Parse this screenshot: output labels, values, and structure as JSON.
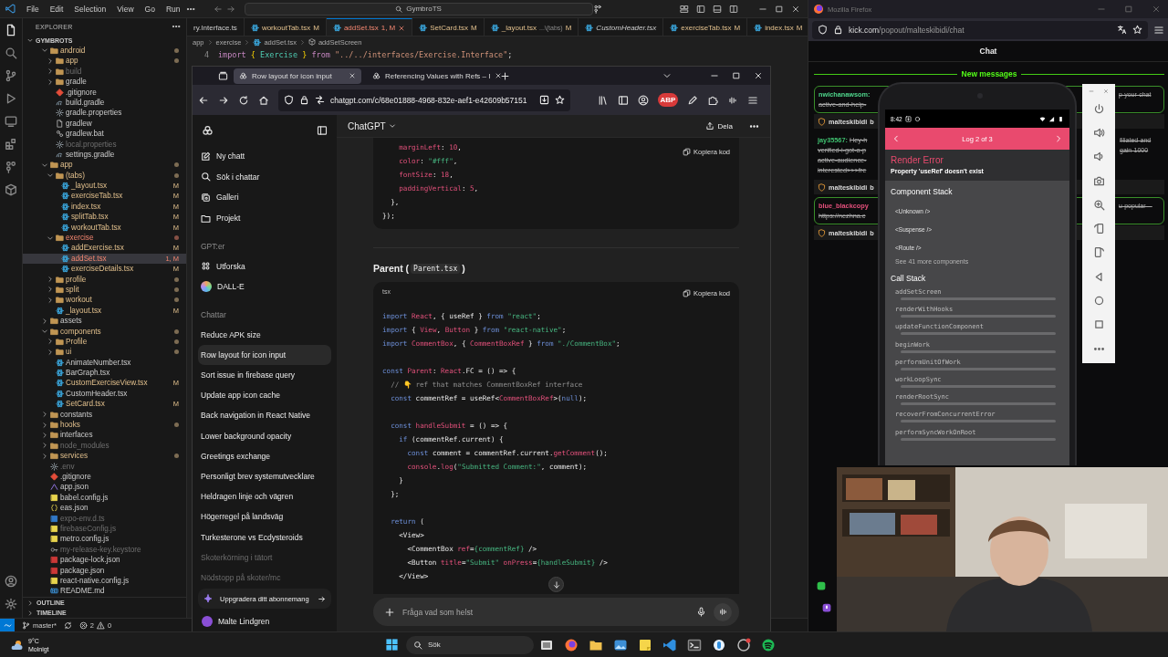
{
  "vscode": {
    "menu": [
      "File",
      "Edit",
      "Selection",
      "View",
      "Go",
      "Run"
    ],
    "command_center": "GymbroTS",
    "explorer": {
      "title": "EXPLORER",
      "root": {
        "name": "GYMBROTS",
        "expanded": true
      },
      "tree": [
        {
          "name": "android",
          "kind": "folder",
          "expanded": true,
          "modified": true,
          "dot": true,
          "selected": false,
          "children": [
            {
              "name": "app",
              "kind": "folder",
              "expanded": false,
              "modified": true,
              "dot": true,
              "selected": false
            },
            {
              "name": "build",
              "kind": "folder",
              "expanded": false,
              "ignored": true,
              "selected": false
            },
            {
              "name": "gradle",
              "kind": "folder",
              "expanded": false,
              "selected": false
            },
            {
              "name": ".gitignore",
              "kind": "git",
              "selected": false
            },
            {
              "name": "build.gradle",
              "kind": "gradle",
              "selected": false
            },
            {
              "name": "gradle.properties",
              "kind": "config",
              "selected": false
            },
            {
              "name": "gradlew",
              "kind": "file",
              "selected": false
            },
            {
              "name": "gradlew.bat",
              "kind": "script",
              "selected": false
            },
            {
              "name": "local.properties",
              "kind": "config",
              "ignored": true,
              "selected": false
            },
            {
              "name": "settings.gradle",
              "kind": "gradle",
              "selected": false
            }
          ]
        },
        {
          "name": "app",
          "kind": "folder",
          "expanded": true,
          "modified": true,
          "dot": true,
          "selected": false,
          "children": [
            {
              "name": "(tabs)",
              "kind": "folder",
              "expanded": true,
              "modified": true,
              "dot": true,
              "selected": false,
              "children": [
                {
                  "name": "_layout.tsx",
                  "kind": "tsx",
                  "modified": true,
                  "badge": "M",
                  "selected": false
                },
                {
                  "name": "exerciseTab.tsx",
                  "kind": "tsx",
                  "modified": true,
                  "badge": "M",
                  "selected": false
                },
                {
                  "name": "index.tsx",
                  "kind": "tsx",
                  "modified": true,
                  "badge": "M",
                  "selected": false
                },
                {
                  "name": "splitTab.tsx",
                  "kind": "tsx",
                  "modified": true,
                  "badge": "M",
                  "selected": false
                },
                {
                  "name": "workoutTab.tsx",
                  "kind": "tsx",
                  "modified": true,
                  "badge": "M",
                  "selected": false
                }
              ]
            },
            {
              "name": "exercise",
              "kind": "folder",
              "expanded": true,
              "error": true,
              "dot": true,
              "selected": false,
              "children": [
                {
                  "name": "addExercise.tsx",
                  "kind": "tsx",
                  "modified": true,
                  "badge": "M",
                  "selected": false
                },
                {
                  "name": "addSet.tsx",
                  "kind": "tsx",
                  "error": true,
                  "badge": "1, M",
                  "selected": true
                },
                {
                  "name": "exerciseDetails.tsx",
                  "kind": "tsx",
                  "modified": true,
                  "badge": "M",
                  "selected": false
                }
              ]
            },
            {
              "name": "profile",
              "kind": "folder",
              "expanded": false,
              "modified": true,
              "dot": true,
              "selected": false
            },
            {
              "name": "split",
              "kind": "folder",
              "expanded": false,
              "modified": true,
              "dot": true,
              "selected": false
            },
            {
              "name": "workout",
              "kind": "folder",
              "expanded": false,
              "modified": true,
              "dot": true,
              "selected": false
            },
            {
              "name": "_layout.tsx",
              "kind": "tsx",
              "modified": true,
              "badge": "M",
              "selected": false
            }
          ]
        },
        {
          "name": "assets",
          "kind": "folder",
          "expanded": false,
          "selected": false
        },
        {
          "name": "components",
          "kind": "folder",
          "expanded": true,
          "modified": true,
          "dot": true,
          "selected": false,
          "children": [
            {
              "name": "Profile",
              "kind": "folder",
              "expanded": false,
              "modified": true,
              "dot": true,
              "selected": false
            },
            {
              "name": "ui",
              "kind": "folder",
              "expanded": false,
              "modified": true,
              "dot": true,
              "selected": false
            },
            {
              "name": "AnimateNumber.tsx",
              "kind": "tsx",
              "selected": false
            },
            {
              "name": "BarGraph.tsx",
              "kind": "tsx",
              "selected": false
            },
            {
              "name": "CustomExerciseView.tsx",
              "kind": "tsx",
              "modified": true,
              "badge": "M",
              "selected": false
            },
            {
              "name": "CustomHeader.tsx",
              "kind": "tsx",
              "selected": false
            },
            {
              "name": "SetCard.tsx",
              "kind": "tsx",
              "modified": true,
              "badge": "M",
              "selected": false
            }
          ]
        },
        {
          "name": "constants",
          "kind": "folder",
          "expanded": false,
          "selected": false
        },
        {
          "name": "hooks",
          "kind": "folder",
          "expanded": false,
          "modified": true,
          "dot": true,
          "selected": false
        },
        {
          "name": "interfaces",
          "kind": "folder",
          "expanded": false,
          "selected": false
        },
        {
          "name": "node_modules",
          "kind": "folder",
          "expanded": false,
          "ignored": true,
          "selected": false
        },
        {
          "name": "services",
          "kind": "folder",
          "expanded": false,
          "modified": true,
          "dot": true,
          "selected": false
        },
        {
          "name": ".env",
          "kind": "config",
          "ignored": true,
          "selected": false
        },
        {
          "name": ".gitignore",
          "kind": "git",
          "selected": false
        },
        {
          "name": "app.json",
          "kind": "expo",
          "selected": false
        },
        {
          "name": "babel.config.js",
          "kind": "js",
          "selected": false
        },
        {
          "name": "eas.json",
          "kind": "json",
          "selected": false
        },
        {
          "name": "expo-env.d.ts",
          "kind": "ts",
          "ignored": true,
          "selected": false
        },
        {
          "name": "firebaseConfig.js",
          "kind": "js",
          "ignored": true,
          "selected": false
        },
        {
          "name": "metro.config.js",
          "kind": "js",
          "selected": false
        },
        {
          "name": "my-release-key.keystore",
          "kind": "key",
          "ignored": true,
          "selected": false
        },
        {
          "name": "package-lock.json",
          "kind": "npm",
          "selected": false
        },
        {
          "name": "package.json",
          "kind": "npm",
          "selected": false
        },
        {
          "name": "react-native.config.js",
          "kind": "js",
          "selected": false
        },
        {
          "name": "README.md",
          "kind": "md",
          "selected": false
        }
      ]
    },
    "panels": [
      {
        "label": "OUTLINE",
        "expanded": false
      },
      {
        "label": "TIMELINE",
        "expanded": false
      }
    ],
    "tabs": [
      {
        "name": "ry.Interface.ts",
        "selected": false
      },
      {
        "name": "workoutTab.tsx",
        "kind": "tsx",
        "badge": "M",
        "modified": true,
        "selected": false
      },
      {
        "name": "addSet.tsx",
        "kind": "tsx",
        "badge": "1, M",
        "error": true,
        "selected": true
      },
      {
        "name": "SetCard.tsx",
        "kind": "tsx",
        "badge": "M",
        "modified": true,
        "selected": false
      },
      {
        "name": "_layout.tsx",
        "kind": "tsx",
        "description": "...\\(tabs)",
        "badge": "M",
        "modified": true,
        "selected": false
      },
      {
        "name": "CustomHeader.tsx",
        "kind": "tsx",
        "preview": true,
        "selected": false
      },
      {
        "name": "exerciseTab.tsx",
        "kind": "tsx",
        "badge": "M",
        "modified": true,
        "selected": false
      },
      {
        "name": "index.tsx",
        "kind": "tsx",
        "badge": "M",
        "modified": true,
        "selected": false
      }
    ],
    "breadcrumb": [
      "app",
      "exercise",
      "addSet.tsx",
      "addSetScreen"
    ],
    "editor_line": {
      "number": "4",
      "tokens": [
        {
          "kind": "kw",
          "text": "import "
        },
        {
          "kind": "br",
          "text": "{ "
        },
        {
          "kind": "ty",
          "text": "Exercise"
        },
        {
          "kind": "br",
          "text": " } "
        },
        {
          "kind": "kw",
          "text": "from "
        },
        {
          "kind": "str",
          "text": "\"../../interfaces/Exercise.Interface\""
        },
        {
          "kind": "pl",
          "text": ";"
        }
      ]
    },
    "status_bar": {
      "branch": "master*",
      "errors": "2",
      "warnings": "0"
    }
  },
  "browser": {
    "tabs": [
      {
        "title": "Row layout for icon input",
        "selected": true
      },
      {
        "title": "Referencing Values with Refs – I",
        "selected": false
      }
    ],
    "url": "chatgpt.com/c/68e01888-4968-832e-aef1-e42609b57151",
    "extension_badge": "ABP"
  },
  "chatgpt": {
    "nav": [
      {
        "label": "Ny chatt",
        "kind": "edit"
      },
      {
        "label": "Sök i chattar",
        "kind": "search"
      },
      {
        "label": "Galleri",
        "kind": "gallery"
      },
      {
        "label": "Projekt",
        "kind": "folder"
      }
    ],
    "gpts_heading": "GPT:er",
    "gpts": [
      {
        "label": "Utforska",
        "kind": "grid"
      },
      {
        "label": "DALL-E",
        "kind": "avatar"
      }
    ],
    "chats_heading": "Chattar",
    "chats": [
      {
        "title": "Reduce APK size",
        "selected": false
      },
      {
        "title": "Row layout for icon input",
        "selected": true
      },
      {
        "title": "Sort issue in firebase query",
        "selected": false
      },
      {
        "title": "Update app icon cache",
        "selected": false
      },
      {
        "title": "Back navigation in React Native",
        "selected": false
      },
      {
        "title": "Lower background opacity",
        "selected": false
      },
      {
        "title": "Greetings exchange",
        "selected": false
      },
      {
        "title": "Personligt brev systemutvecklare",
        "selected": false
      },
      {
        "title": "Heldragen linje och vägren",
        "selected": false
      },
      {
        "title": "Högerregel på landsväg",
        "selected": false
      },
      {
        "title": "Turkesterone vs Ecdysteroids",
        "selected": false
      },
      {
        "title": "Skoterkörning i tätort",
        "selected": false,
        "faded": true
      },
      {
        "title": "Nödstopp på skoter/mc",
        "selected": false,
        "faded": true
      }
    ],
    "upgrade": "Uppgradera ditt abonnemang",
    "user": "Malte Lindgren",
    "model": "ChatGPT",
    "share": "Dela",
    "blocks": [
      {
        "kind": "code",
        "copy": "Kopiera kod",
        "lines": [
          {
            "tokens": [
              {
                "kind": "id",
                "text": "    marginLeft"
              },
              {
                "kind": "pl",
                "text": ": "
              },
              {
                "kind": "num",
                "text": "10"
              },
              {
                "kind": "pl",
                "text": ","
              }
            ]
          },
          {
            "tokens": [
              {
                "kind": "id",
                "text": "    color"
              },
              {
                "kind": "pl",
                "text": ": "
              },
              {
                "kind": "str",
                "text": "\"#fff\""
              },
              {
                "kind": "pl",
                "text": ","
              }
            ]
          },
          {
            "tokens": [
              {
                "kind": "id",
                "text": "    fontSize"
              },
              {
                "kind": "pl",
                "text": ": "
              },
              {
                "kind": "num",
                "text": "18"
              },
              {
                "kind": "pl",
                "text": ","
              }
            ]
          },
          {
            "tokens": [
              {
                "kind": "id",
                "text": "    paddingVertical"
              },
              {
                "kind": "pl",
                "text": ": "
              },
              {
                "kind": "num",
                "text": "5"
              },
              {
                "kind": "pl",
                "text": ","
              }
            ]
          },
          {
            "tokens": [
              {
                "kind": "pl",
                "text": "  },"
              }
            ]
          },
          {
            "tokens": [
              {
                "kind": "pl",
                "text": "});"
              }
            ]
          }
        ]
      },
      {
        "kind": "heading",
        "text": "Parent (",
        "code": "Parent.tsx",
        "after": ")"
      },
      {
        "kind": "code",
        "language": "tsx",
        "copy": "Kopiera kod",
        "lines": [
          {
            "tokens": [
              {
                "kind": "kw",
                "text": "import "
              },
              {
                "kind": "id",
                "text": "React"
              },
              {
                "kind": "pl",
                "text": ", { useRef } "
              },
              {
                "kind": "kw",
                "text": "from "
              },
              {
                "kind": "str",
                "text": "\"react\""
              },
              {
                "kind": "pl",
                "text": ";"
              }
            ]
          },
          {
            "tokens": [
              {
                "kind": "kw",
                "text": "import "
              },
              {
                "kind": "pl",
                "text": "{ "
              },
              {
                "kind": "id",
                "text": "View"
              },
              {
                "kind": "pl",
                "text": ", "
              },
              {
                "kind": "id",
                "text": "Button"
              },
              {
                "kind": "pl",
                "text": " } "
              },
              {
                "kind": "kw",
                "text": "from "
              },
              {
                "kind": "str",
                "text": "\"react-native\""
              },
              {
                "kind": "pl",
                "text": ";"
              }
            ]
          },
          {
            "tokens": [
              {
                "kind": "kw",
                "text": "import "
              },
              {
                "kind": "id",
                "text": "CommentBox"
              },
              {
                "kind": "pl",
                "text": ", { "
              },
              {
                "kind": "id",
                "text": "CommentBoxRef"
              },
              {
                "kind": "pl",
                "text": " } "
              },
              {
                "kind": "kw",
                "text": "from "
              },
              {
                "kind": "str",
                "text": "\"./CommentBox\""
              },
              {
                "kind": "pl",
                "text": ";"
              }
            ]
          },
          {
            "blank_before": true,
            "tokens": [
              {
                "kind": "kw",
                "text": "const "
              },
              {
                "kind": "id",
                "text": "Parent"
              },
              {
                "kind": "pl",
                "text": ": "
              },
              {
                "kind": "id",
                "text": "React"
              },
              {
                "kind": "pl",
                "text": ".FC = () => {"
              }
            ]
          },
          {
            "tokens": [
              {
                "kind": "cm",
                "text": "  // 👇 ref that matches CommentBoxRef interface"
              }
            ]
          },
          {
            "tokens": [
              {
                "kind": "kw",
                "text": "  const "
              },
              {
                "kind": "pl",
                "text": "commentRef = useRef<"
              },
              {
                "kind": "id",
                "text": "CommentBoxRef"
              },
              {
                "kind": "pl",
                "text": ">("
              },
              {
                "kind": "kw",
                "text": "null"
              },
              {
                "kind": "pl",
                "text": ");"
              }
            ]
          },
          {
            "blank_before": true,
            "tokens": [
              {
                "kind": "kw",
                "text": "  const "
              },
              {
                "kind": "id",
                "text": "handleSubmit"
              },
              {
                "kind": "pl",
                "text": " = () => {"
              }
            ]
          },
          {
            "tokens": [
              {
                "kind": "kw",
                "text": "    if "
              },
              {
                "kind": "pl",
                "text": "(commentRef.current) {"
              }
            ]
          },
          {
            "tokens": [
              {
                "kind": "kw",
                "text": "      const "
              },
              {
                "kind": "pl",
                "text": "comment = commentRef.current."
              },
              {
                "kind": "id",
                "text": "getComment"
              },
              {
                "kind": "pl",
                "text": "();"
              }
            ]
          },
          {
            "tokens": [
              {
                "kind": "id",
                "text": "      console"
              },
              {
                "kind": "pl",
                "text": "."
              },
              {
                "kind": "id",
                "text": "log"
              },
              {
                "kind": "pl",
                "text": "("
              },
              {
                "kind": "str",
                "text": "\"Submitted Comment:\""
              },
              {
                "kind": "pl",
                "text": ", comment);"
              }
            ]
          },
          {
            "tokens": [
              {
                "kind": "pl",
                "text": "    }"
              }
            ]
          },
          {
            "tokens": [
              {
                "kind": "pl",
                "text": "  };"
              }
            ]
          },
          {
            "blank_before": true,
            "tokens": [
              {
                "kind": "kw",
                "text": "  return "
              },
              {
                "kind": "pl",
                "text": "("
              }
            ]
          },
          {
            "tokens": [
              {
                "kind": "pl",
                "text": "    <View>"
              }
            ]
          },
          {
            "tokens": [
              {
                "kind": "pl",
                "text": "      <CommentBox "
              },
              {
                "kind": "id",
                "text": "ref"
              },
              {
                "kind": "pl",
                "text": "="
              },
              {
                "kind": "str",
                "text": "{commentRef}"
              },
              {
                "kind": "pl",
                "text": " />"
              }
            ]
          },
          {
            "tokens": [
              {
                "kind": "pl",
                "text": "      <Button "
              },
              {
                "kind": "id",
                "text": "title"
              },
              {
                "kind": "pl",
                "text": "="
              },
              {
                "kind": "str",
                "text": "\"Submit\" "
              },
              {
                "kind": "id",
                "text": "onPress"
              },
              {
                "kind": "pl",
                "text": "="
              },
              {
                "kind": "str",
                "text": "{handleSubmit}"
              },
              {
                "kind": "pl",
                "text": " />"
              }
            ]
          },
          {
            "tokens": [
              {
                "kind": "pl",
                "text": "    </View>"
              }
            ]
          }
        ]
      }
    ],
    "composer_placeholder": "Fråga vad som helst"
  },
  "kick": {
    "window_title": "Mozilla Firefox",
    "url_host": "kick.com",
    "url_path": "/popout/malteskibidi/chat",
    "heading": "Chat",
    "new_messages": "New messages",
    "messages": [
      {
        "kind": "highlight",
        "user": "nwichanawsom:",
        "color": "#4fd68c",
        "deleted": true,
        "lines": [
          "active-and-help-"
        ],
        "right": [
          "p-your-chat"
        ]
      },
      {
        "kind": "mod",
        "user": "malteskibidi",
        "text": "b"
      },
      {
        "kind": "plain",
        "user": "jay35567:",
        "color": "#3fbf6f",
        "text": "Hey-h",
        "deleted": true,
        "lines": [
          "verified-i-got-a-p",
          "active-audience-",
          "interested>>>fre"
        ],
        "right": [
          "filiated-and",
          "gain-1000"
        ]
      },
      {
        "kind": "mod",
        "user": "malteskibidi",
        "text": "b"
      },
      {
        "kind": "highlight",
        "user": "blue_blackcopy",
        "color": "#e4507c",
        "deleted": true,
        "lines": [
          "https://nezhna.c"
        ],
        "right": [
          "u-popular—"
        ]
      },
      {
        "kind": "mod",
        "user": "malteskibidi",
        "text": "b"
      }
    ]
  },
  "phone": {
    "time": "8:42",
    "title": "Log 2 of 3",
    "error_title": "Render Error",
    "error_message": "Property 'useRef' doesn't exist",
    "component_heading": "Component Stack",
    "components": [
      "<Unknown />",
      "<Suspense />",
      "<Route />"
    ],
    "more_components": "See 41 more components",
    "call_heading": "Call Stack",
    "calls": [
      "addSetScreen",
      "renderWithHooks",
      "updateFunctionComponent",
      "beginWork",
      "performUnitOfWork",
      "workLoopSync",
      "renderRootSync",
      "recoverFromConcurrentError",
      "performSyncWorkOnRoot"
    ]
  },
  "taskbar": {
    "temperature": "9°C",
    "weather": "Molnigt",
    "search_placeholder": "Sök"
  }
}
